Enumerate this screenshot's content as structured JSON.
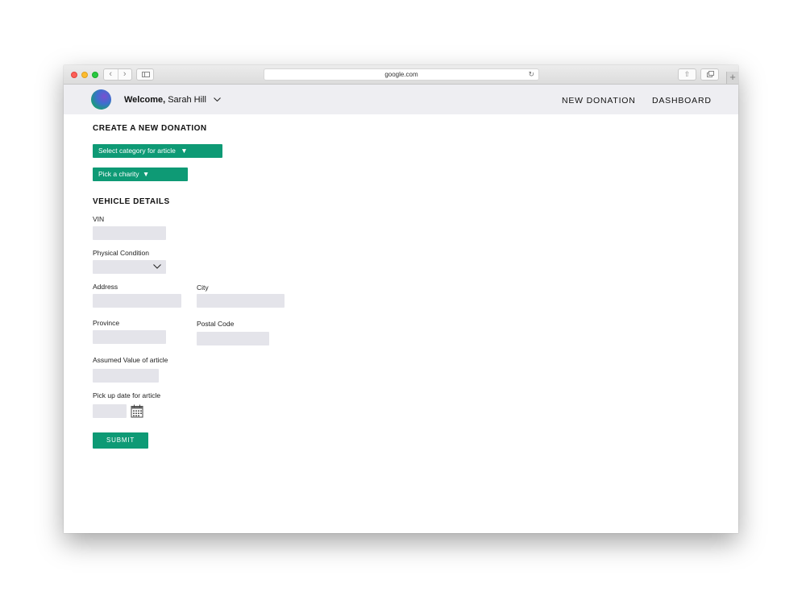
{
  "browser": {
    "url": "google.com",
    "icons": [
      "back-icon",
      "forward-icon",
      "sidebar-icon",
      "reload-icon",
      "share-icon",
      "tabs-icon",
      "plus-icon"
    ]
  },
  "header": {
    "welcome_label": "Welcome,",
    "user_name": "Sarah Hill",
    "nav": {
      "new_donation": "NEW DONATION",
      "dashboard": "DASHBOARD"
    }
  },
  "form": {
    "title": "CREATE A NEW DONATION",
    "category_select": "Select category for article",
    "charity_select": "Pick a charity",
    "dropdown_arrow": "▼",
    "vehicle_section": "VEHICLE DETAILS",
    "fields": {
      "vin": "VIN",
      "physical_condition": "Physical Condition",
      "address": "Address",
      "city": "City",
      "province": "Province",
      "postal_code": "Postal Code",
      "assumed_value": "Assumed Value of article",
      "pickup_date": "Pick up date for article"
    },
    "submit": "SUBMIT"
  },
  "colors": {
    "accent": "#0e9a75",
    "field_bg": "#e4e4ea",
    "header_bg": "#eeeef2"
  }
}
